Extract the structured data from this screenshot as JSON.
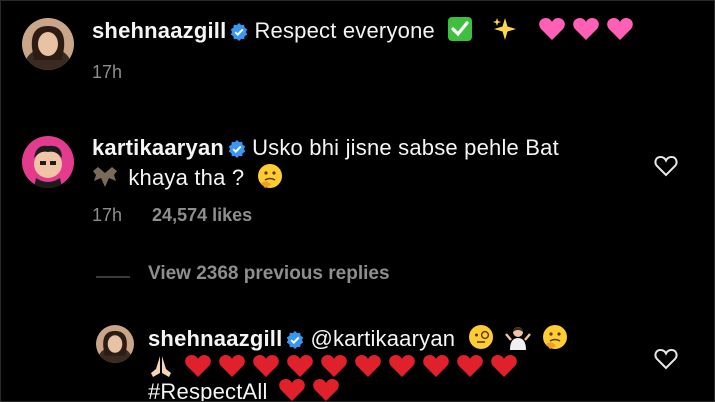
{
  "comment1": {
    "username": "shehnaazgill",
    "text": "Respect everyone",
    "emojis": [
      "check-mark-icon",
      "sparkles-icon",
      "pink-heart-icon",
      "pink-heart-icon",
      "pink-heart-icon"
    ],
    "time": "17h"
  },
  "comment2": {
    "username": "kartikaaryan",
    "text_line1": "Usko bhi jisne sabse pehle Bat",
    "text_line2": "khaya tha ?",
    "emojis": [
      "bat-icon",
      "thinking-face-icon"
    ],
    "time": "17h",
    "likes": "24,574 likes"
  },
  "thread": {
    "view_replies": "View 2368 previous replies"
  },
  "reply1": {
    "username": "shehnaazgill",
    "mention": "@kartikaaryan",
    "emojis": [
      "face-with-monocle-icon",
      "person-shrugging-icon",
      "thinking-face-icon",
      "folded-hands-icon"
    ],
    "red_hearts": 12,
    "hashtag": "#RespectAll"
  },
  "colors": {
    "background": "#000000",
    "text": "#f5f5f5",
    "meta": "#8e8e8e",
    "verified": "#3897f0",
    "red_heart": "#e0202a",
    "pink_heart": "#ff5fb4"
  }
}
